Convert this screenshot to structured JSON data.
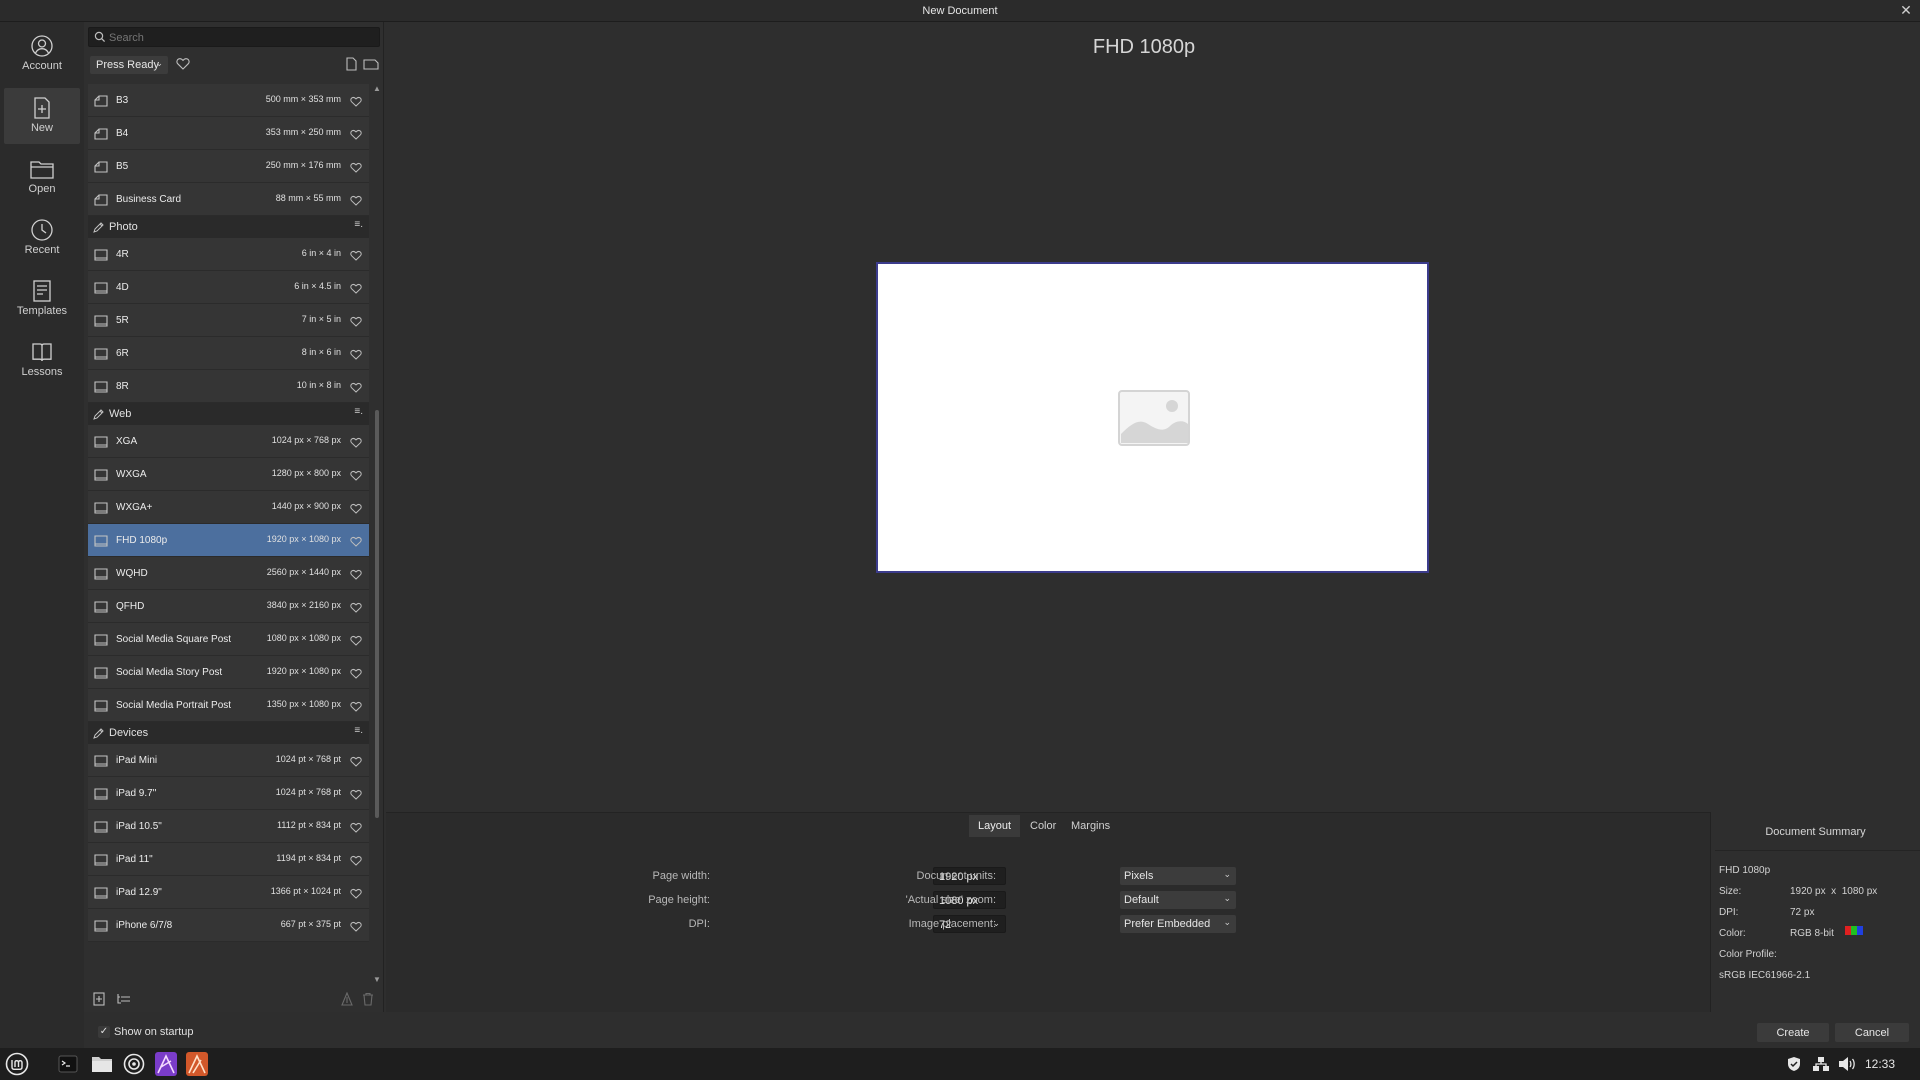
{
  "window": {
    "title": "New Document"
  },
  "nav": [
    {
      "label": "Account",
      "icon": "account-icon"
    },
    {
      "label": "New",
      "icon": "new-document-icon"
    },
    {
      "label": "Open",
      "icon": "folder-open-icon"
    },
    {
      "label": "Recent",
      "icon": "clock-icon"
    },
    {
      "label": "Templates",
      "icon": "templates-icon"
    },
    {
      "label": "Lessons",
      "icon": "book-icon"
    }
  ],
  "search": {
    "placeholder": "Search"
  },
  "category": {
    "selected": "Press Ready"
  },
  "presets": {
    "print_rows": [
      {
        "name": "B3",
        "size": "500 mm × 353 mm"
      },
      {
        "name": "B4",
        "size": "353 mm × 250 mm"
      },
      {
        "name": "B5",
        "size": "250 mm × 176 mm"
      },
      {
        "name": "Business Card",
        "size": "88 mm × 55 mm"
      }
    ],
    "photo": {
      "label": "Photo",
      "rows": [
        {
          "name": "4R",
          "size": "6 in × 4 in"
        },
        {
          "name": "4D",
          "size": "6 in × 4.5 in"
        },
        {
          "name": "5R",
          "size": "7 in × 5 in"
        },
        {
          "name": "6R",
          "size": "8 in × 6 in"
        },
        {
          "name": "8R",
          "size": "10 in × 8 in"
        }
      ]
    },
    "web": {
      "label": "Web",
      "rows": [
        {
          "name": "XGA",
          "size": "1024 px × 768 px"
        },
        {
          "name": "WXGA",
          "size": "1280 px × 800 px"
        },
        {
          "name": "WXGA+",
          "size": "1440 px × 900 px"
        },
        {
          "name": "FHD 1080p",
          "size": "1920 px × 1080 px"
        },
        {
          "name": "WQHD",
          "size": "2560 px × 1440 px"
        },
        {
          "name": "QFHD",
          "size": "3840 px × 2160 px"
        },
        {
          "name": "Social Media Square Post",
          "size": "1080 px × 1080 px"
        },
        {
          "name": "Social Media Story Post",
          "size": "1920 px × 1080 px"
        },
        {
          "name": "Social Media Portrait Post",
          "size": "1350 px × 1080 px"
        }
      ]
    },
    "devices": {
      "label": "Devices",
      "rows": [
        {
          "name": "iPad Mini",
          "size": "1024 pt × 768 pt"
        },
        {
          "name": "iPad 9.7\"",
          "size": "1024 pt × 768 pt"
        },
        {
          "name": "iPad 10.5\"",
          "size": "1112 pt × 834 pt"
        },
        {
          "name": "iPad 11\"",
          "size": "1194 pt × 834 pt"
        },
        {
          "name": "iPad 12.9\"",
          "size": "1366 pt × 1024 pt"
        },
        {
          "name": "iPhone 6/7/8",
          "size": "667 pt × 375 pt"
        }
      ]
    },
    "section_menu_glyph": "≡."
  },
  "startup": {
    "label": "Show on startup",
    "checked": true
  },
  "preview": {
    "title": "FHD 1080p"
  },
  "tabs": [
    "Layout",
    "Color",
    "Margins"
  ],
  "fields": {
    "page_width": {
      "label": "Page width:",
      "value": "1920 px"
    },
    "page_height": {
      "label": "Page height:",
      "value": "1080 px"
    },
    "dpi": {
      "label": "DPI:",
      "value": "72"
    },
    "document_units": {
      "label": "Document units:",
      "value": "Pixels"
    },
    "actual_size_zoom": {
      "label": "'Actual size' zoom:",
      "value": "Default"
    },
    "image_placement": {
      "label": "Image placement:",
      "value": "Prefer Embedded"
    }
  },
  "summary": {
    "heading": "Document Summary",
    "name": "FHD 1080p",
    "size_label": "Size:",
    "size_value": "1920 px  x  1080 px",
    "dpi_label": "DPI:",
    "dpi_value": "72 px",
    "color_label": "Color:",
    "color_value": "RGB 8-bit",
    "profile_label": "Color Profile:",
    "profile_value": "sRGB IEC61966-2.1",
    "swatches": [
      "#e02020",
      "#20c020",
      "#2040e0"
    ]
  },
  "buttons": {
    "create": "Create",
    "cancel": "Cancel"
  },
  "taskbar": {
    "clock": "12:33"
  },
  "colors": {
    "selection": "#4c6f9e",
    "background": "#2e2e2e",
    "canvas_border": "#3c3c8c"
  }
}
